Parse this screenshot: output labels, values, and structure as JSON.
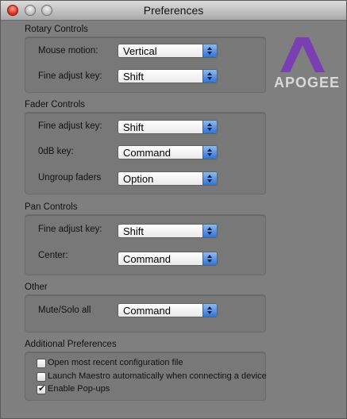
{
  "window": {
    "title": "Preferences"
  },
  "brand": {
    "name": "APOGEE",
    "accent": "#7a3fb3"
  },
  "sections": {
    "rotary": {
      "title": "Rotary Controls",
      "rows": [
        {
          "label": "Mouse motion:",
          "value": "Vertical"
        },
        {
          "label": "Fine adjust key:",
          "value": "Shift"
        }
      ]
    },
    "fader": {
      "title": "Fader Controls",
      "rows": [
        {
          "label": "Fine adjust key:",
          "value": "Shift"
        },
        {
          "label": "0dB key:",
          "value": "Command"
        },
        {
          "label": "Ungroup faders",
          "value": "Option"
        }
      ]
    },
    "pan": {
      "title": "Pan Controls",
      "rows": [
        {
          "label": "Fine adjust key:",
          "value": "Shift"
        },
        {
          "label": "Center:",
          "value": "Command"
        }
      ]
    },
    "other": {
      "title": "Other",
      "rows": [
        {
          "label": "Mute/Solo all",
          "value": "Command"
        }
      ]
    },
    "additional": {
      "title": "Additional Preferences",
      "options": [
        {
          "label": "Open most recent configuration file",
          "checked": false
        },
        {
          "label": "Launch Maestro automatically when connecting a device",
          "checked": false
        },
        {
          "label": "Enable Pop-ups",
          "checked": true
        }
      ]
    }
  },
  "checkmark": "✔"
}
